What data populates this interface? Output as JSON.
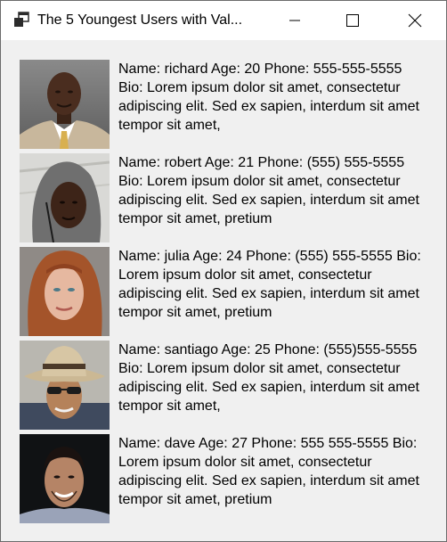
{
  "window": {
    "title": "The 5 Youngest Users with Val...",
    "icon": "app-window-icon"
  },
  "users": [
    {
      "text": "Name: richard Age: 20 Phone: 555-555-5555 Bio: Lorem ipsum dolor sit amet, consectetur adipiscing elit. Sed ex sapien, interdum sit amet tempor sit amet,"
    },
    {
      "text": "Name: robert Age: 21 Phone: (555) 555-5555 Bio: Lorem ipsum dolor sit amet, consectetur adipiscing elit. Sed ex sapien, interdum sit amet tempor sit amet, pretium"
    },
    {
      "text": "Name: julia Age: 24 Phone: (555) 555-5555 Bio: Lorem ipsum dolor sit amet, consectetur adipiscing elit. Sed ex sapien, interdum sit amet tempor sit amet, pretium"
    },
    {
      "text": "Name: santiago Age: 25 Phone: (555)555-5555 Bio: Lorem ipsum dolor sit amet, consectetur adipiscing elit. Sed ex sapien, interdum sit amet tempor sit amet,"
    },
    {
      "text": "Name: dave Age: 27 Phone: 555 555-5555 Bio: Lorem ipsum dolor sit amet, consectetur adipiscing elit. Sed ex sapien, interdum sit amet tempor sit amet, pretium"
    }
  ]
}
